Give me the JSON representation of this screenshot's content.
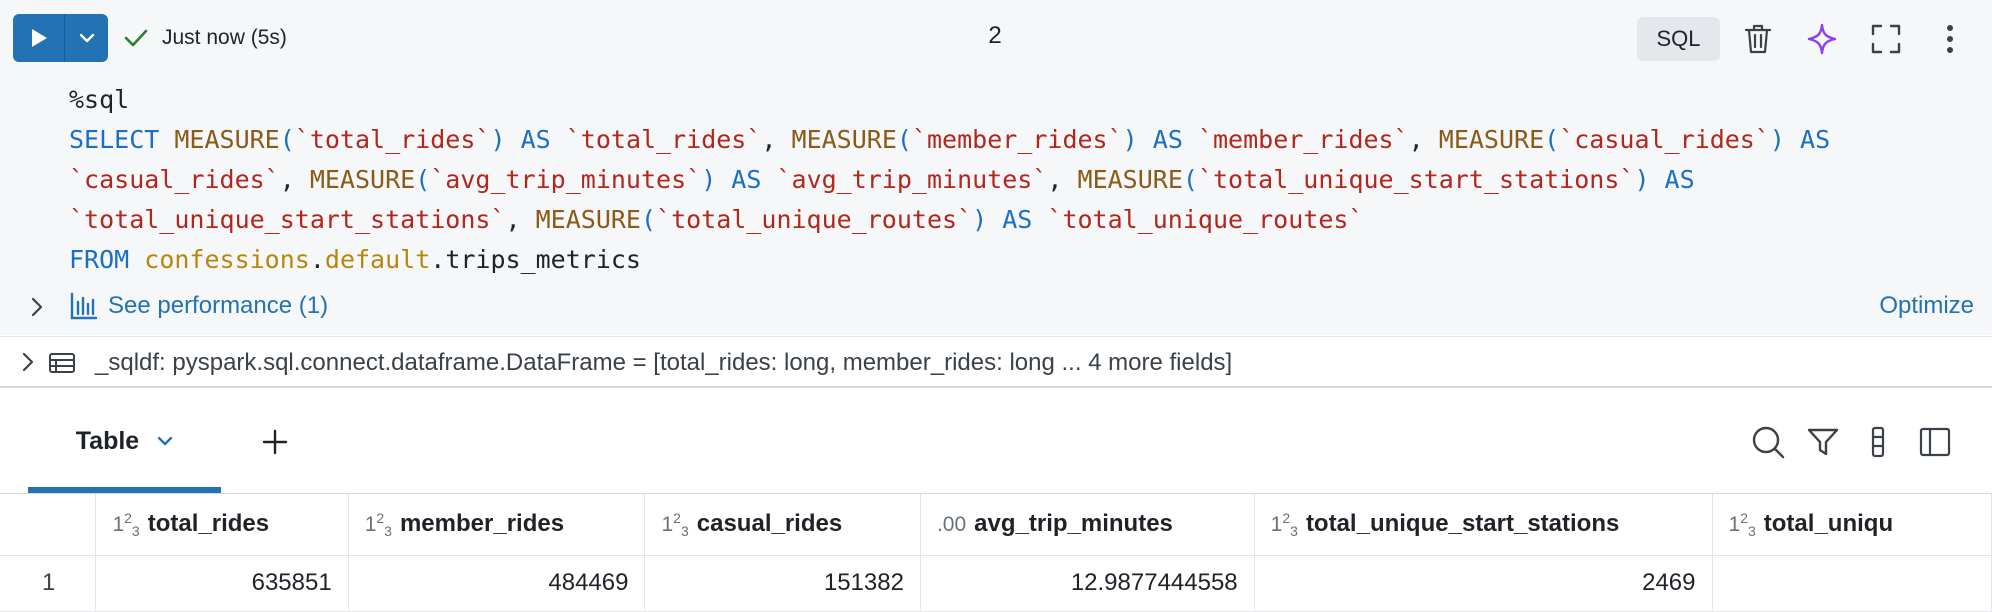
{
  "toolbar": {
    "status_text": "Just now (5s)",
    "cell_number": "2",
    "language": "SQL"
  },
  "code": {
    "lines": [
      [
        {
          "t": "plain",
          "v": "%sql"
        }
      ],
      [
        {
          "t": "kw",
          "v": "SELECT "
        },
        {
          "t": "fn",
          "v": "MEASURE"
        },
        {
          "t": "kw",
          "v": "("
        },
        {
          "t": "str",
          "v": "`total_rides`"
        },
        {
          "t": "kw",
          "v": ")"
        },
        {
          "t": "kw",
          "v": " AS "
        },
        {
          "t": "str",
          "v": "`total_rides`"
        },
        {
          "t": "plain",
          "v": ", "
        },
        {
          "t": "fn",
          "v": "MEASURE"
        },
        {
          "t": "kw",
          "v": "("
        },
        {
          "t": "str",
          "v": "`member_rides`"
        },
        {
          "t": "kw",
          "v": ")"
        },
        {
          "t": "kw",
          "v": " AS "
        },
        {
          "t": "str",
          "v": "`member_rides`"
        },
        {
          "t": "plain",
          "v": ", "
        },
        {
          "t": "fn",
          "v": "MEASURE"
        },
        {
          "t": "kw",
          "v": "("
        },
        {
          "t": "str",
          "v": "`casual_rides`"
        },
        {
          "t": "kw",
          "v": ")"
        },
        {
          "t": "kw",
          "v": " AS"
        }
      ],
      [
        {
          "t": "str",
          "v": "`casual_rides`"
        },
        {
          "t": "plain",
          "v": ", "
        },
        {
          "t": "fn",
          "v": "MEASURE"
        },
        {
          "t": "kw",
          "v": "("
        },
        {
          "t": "str",
          "v": "`avg_trip_minutes`"
        },
        {
          "t": "kw",
          "v": ")"
        },
        {
          "t": "kw",
          "v": " AS "
        },
        {
          "t": "str",
          "v": "`avg_trip_minutes`"
        },
        {
          "t": "plain",
          "v": ", "
        },
        {
          "t": "fn",
          "v": "MEASURE"
        },
        {
          "t": "kw",
          "v": "("
        },
        {
          "t": "str",
          "v": "`total_unique_start_stations`"
        },
        {
          "t": "kw",
          "v": ")"
        },
        {
          "t": "kw",
          "v": " AS"
        }
      ],
      [
        {
          "t": "str",
          "v": "`total_unique_start_stations`"
        },
        {
          "t": "plain",
          "v": ", "
        },
        {
          "t": "fn",
          "v": "MEASURE"
        },
        {
          "t": "kw",
          "v": "("
        },
        {
          "t": "str",
          "v": "`total_unique_routes`"
        },
        {
          "t": "kw",
          "v": ")"
        },
        {
          "t": "kw",
          "v": " AS "
        },
        {
          "t": "str",
          "v": "`total_unique_routes`"
        }
      ],
      [
        {
          "t": "kw",
          "v": "FROM "
        },
        {
          "t": "id",
          "v": "confessions"
        },
        {
          "t": "plain",
          "v": "."
        },
        {
          "t": "id",
          "v": "default"
        },
        {
          "t": "plain",
          "v": ".trips_metrics"
        }
      ]
    ]
  },
  "performance": {
    "link_label": "See performance (1)",
    "optimize_label": "Optimize"
  },
  "dataframe": {
    "summary": "_sqldf:  pyspark.sql.connect.dataframe.DataFrame = [total_rides: long, member_rides: long ... 4 more fields]"
  },
  "results": {
    "tab_label": "Table"
  },
  "grid": {
    "columns": [
      {
        "type": "int",
        "name": "total_rides"
      },
      {
        "type": "int",
        "name": "member_rides"
      },
      {
        "type": "int",
        "name": "casual_rides"
      },
      {
        "type": "decimal",
        "name": "avg_trip_minutes"
      },
      {
        "type": "int",
        "name": "total_unique_start_stations"
      },
      {
        "type": "int",
        "name": "total_uniqu"
      }
    ],
    "rows": [
      {
        "index": "1",
        "cells": [
          "635851",
          "484469",
          "151382",
          "12.9877444558",
          "2469",
          ""
        ]
      }
    ]
  },
  "colors": {
    "accent": "#2272b4",
    "keyword": "#1a6fc4",
    "function": "#8a5a16",
    "string": "#b3261e",
    "identifier": "#b8860b",
    "success": "#2e7d32",
    "ai_sparkle": "#8b3ff0"
  }
}
